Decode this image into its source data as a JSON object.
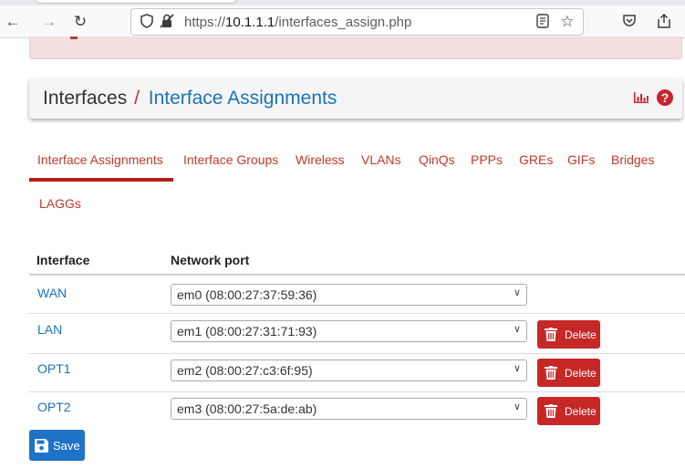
{
  "browser": {
    "url_prefix": "https://",
    "url_host": "10.1.1.1",
    "url_path": "/interfaces_assign.php",
    "back_icon": "back-arrow",
    "forward_icon": "forward-arrow",
    "reload_icon": "reload"
  },
  "header": {
    "section": "Interfaces",
    "separator": "/",
    "page": "Interface Assignments"
  },
  "tabs": [
    {
      "label": "Interface Assignments",
      "active": true
    },
    {
      "label": "Interface Groups"
    },
    {
      "label": "Wireless"
    },
    {
      "label": "VLANs"
    },
    {
      "label": "QinQs"
    },
    {
      "label": "PPPs"
    },
    {
      "label": "GREs"
    },
    {
      "label": "GIFs"
    },
    {
      "label": "Bridges"
    },
    {
      "label": "LAGGs"
    }
  ],
  "table": {
    "headers": [
      "Interface",
      "Network port"
    ],
    "rows": [
      {
        "interface": "WAN",
        "port": "em0 (08:00:27:37:59:36)"
      },
      {
        "interface": "LAN",
        "port": "em1 (08:00:27:31:71:93)",
        "delete": "Delete"
      },
      {
        "interface": "OPT1",
        "port": "em2 (08:00:27:c3:6f:95)",
        "delete": "Delete"
      },
      {
        "interface": "OPT2",
        "port": "em3 (08:00:27:5a:de:ab)",
        "delete": "Delete"
      }
    ]
  },
  "actions": {
    "save_label": "Save"
  },
  "colors": {
    "accent": "#c0392b",
    "link": "#1a73b8",
    "save": "#1e72c8",
    "delete": "#c62828"
  }
}
